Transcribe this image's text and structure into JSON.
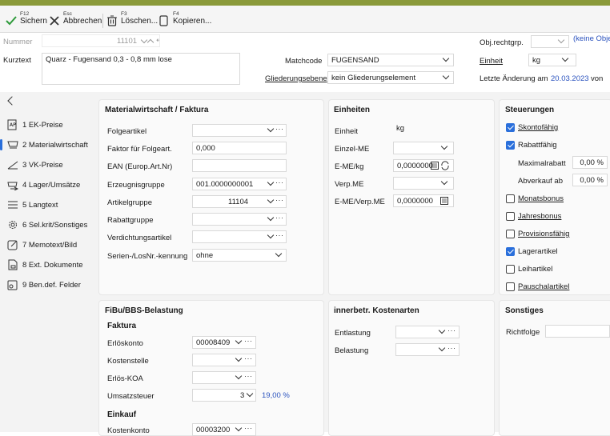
{
  "toolbar": {
    "save": {
      "key": "F12",
      "label": "Sichern"
    },
    "cancel": {
      "key": "Esc",
      "label": "Abbrechen"
    },
    "delete": {
      "key": "F3",
      "label": "Löschen..."
    },
    "copy": {
      "key": "F4",
      "label": "Kopieren..."
    }
  },
  "header": {
    "nummer_label": "Nummer",
    "nummer_value": "11101",
    "kurztext_label": "Kurztext",
    "kurztext_value": "Quarz - Fugensand 0,3 - 0,8 mm lose",
    "matchcode_label": "Matchcode",
    "matchcode_value": "FUGENSAND",
    "gliederung_label": "Gliederungsebene",
    "gliederung_value": "kein Gliederungselement",
    "objrecht_label": "Obj.rechtgrp.",
    "objrecht_value": "",
    "objrecht_hint": "(keine Obje",
    "einheit_label": "Einheit",
    "einheit_value": "kg",
    "letzte_label": "Letzte Änderung am",
    "letzte_date": "20.03.2023",
    "letzte_von": "von"
  },
  "sidebar": {
    "items": [
      {
        "label": "1 EK-Preise"
      },
      {
        "label": "2 Materialwirtschaft"
      },
      {
        "label": "3 VK-Preise"
      },
      {
        "label": "4 Lager/Umsätze"
      },
      {
        "label": "5 Langtext"
      },
      {
        "label": "6 Sel.krit/Sonstiges"
      },
      {
        "label": "7 Memotext/Bild"
      },
      {
        "label": "8 Ext. Dokumente"
      },
      {
        "label": "9 Ben.def. Felder"
      }
    ]
  },
  "materialwirtschaft": {
    "title": "Materialwirtschaft / Faktura",
    "folgeartikel_label": "Folgeartikel",
    "folgeartikel_value": "",
    "faktor_label": "Faktor für Folgeart.",
    "faktor_value": "0,000",
    "ean_label": "EAN (Europ.Art.Nr)",
    "ean_value": "",
    "erzeugnis_label": "Erzeugnisgruppe",
    "erzeugnis_value": "001.0000000001",
    "artikelgruppe_label": "Artikelgruppe",
    "artikelgruppe_value": "11104",
    "rabattgruppe_label": "Rabattgruppe",
    "rabattgruppe_value": "",
    "verdichtung_label": "Verdichtungsartikel",
    "verdichtung_value": "",
    "serien_label": "Serien-/LosNr.-kennung",
    "serien_value": "ohne"
  },
  "einheiten": {
    "title": "Einheiten",
    "einheit_label": "Einheit",
    "einheit_value": "kg",
    "einzel_label": "Einzel-ME",
    "einzel_value": "",
    "emekg_label": "E-ME/kg",
    "emekg_value": "0,0000000",
    "verp_label": "Verp.ME",
    "verp_value": "",
    "emeverp_label": "E-ME/Verp.ME",
    "emeverp_value": "0,0000000"
  },
  "steuerungen": {
    "title": "Steuerungen",
    "skonto": {
      "label": "Skontofähig",
      "checked": true
    },
    "rabatt": {
      "label": "Rabattfähig",
      "checked": true
    },
    "maximalrabatt_label": "Maximalrabatt",
    "maximalrabatt_value": "0,00 %",
    "abverkauf_label": "Abverkauf ab",
    "abverkauf_value": "0,00 %",
    "monatsbonus": {
      "label": "Monatsbonus",
      "checked": false
    },
    "jahresbonus": {
      "label": "Jahresbonus",
      "checked": false
    },
    "provision": {
      "label": "Provisionsfähig",
      "checked": false
    },
    "lagerartikel": {
      "label": "Lagerartikel",
      "checked": true
    },
    "leihartikel": {
      "label": "Leihartikel",
      "checked": false
    },
    "pauschal": {
      "label": "Pauschalartikel",
      "checked": false
    }
  },
  "fibu": {
    "title": "FiBu/BBS-Belastung",
    "faktura_heading": "Faktura",
    "erloeskonto_label": "Erlöskonto",
    "erloeskonto_value": "00008409",
    "kostenstelle_label": "Kostenstelle",
    "kostenstelle_value": "",
    "erloeskoa_label": "Erlös-KOA",
    "erloeskoa_value": "",
    "umsatzsteuer_label": "Umsatzsteuer",
    "umsatzsteuer_value": "3",
    "umsatzsteuer_rate": "19,00 %",
    "einkauf_heading": "Einkauf",
    "kostenkonto_label": "Kostenkonto",
    "kostenkonto_value": "00003200"
  },
  "kostenarten": {
    "title": "innerbetr. Kostenarten",
    "entlastung_label": "Entlastung",
    "entlastung_value": "",
    "belastung_label": "Belastung",
    "belastung_value": ""
  },
  "sonstiges": {
    "title": "Sonstiges",
    "richtfolge_label": "Richtfolge",
    "richtfolge_value": ""
  }
}
